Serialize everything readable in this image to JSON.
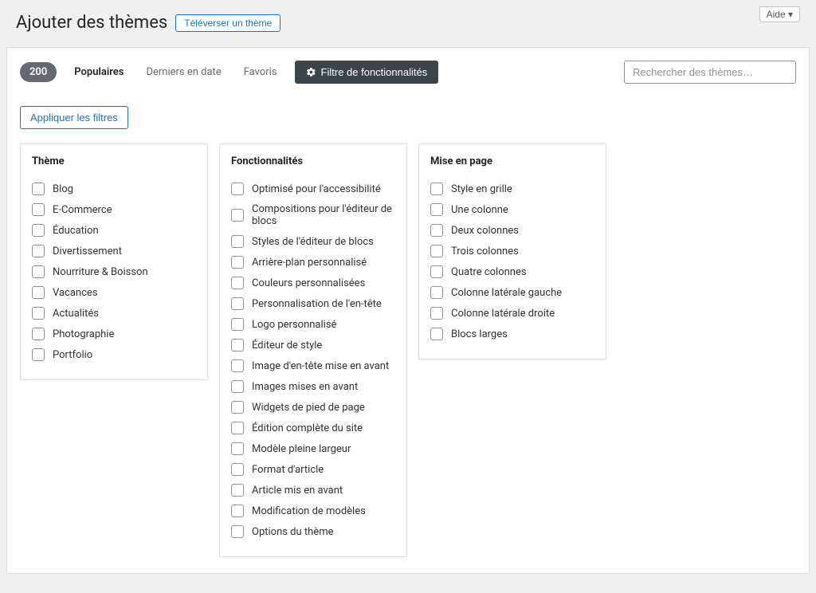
{
  "header": {
    "title": "Ajouter des thèmes",
    "upload_label": "Téléverser un thème",
    "help_label": "Aide ▾"
  },
  "filter_bar": {
    "count": "200",
    "tabs": {
      "popular": "Populaires",
      "latest": "Derniers en date",
      "favorites": "Favoris"
    },
    "feature_filter_label": "Filtre de fonctionnalités",
    "search_placeholder": "Rechercher des thèmes…"
  },
  "apply_label": "Appliquer les filtres",
  "columns": {
    "theme": {
      "title": "Thème",
      "items": [
        "Blog",
        "E-Commerce",
        "Éducation",
        "Divertissement",
        "Nourriture & Boisson",
        "Vacances",
        "Actualités",
        "Photographie",
        "Portfolio"
      ]
    },
    "features": {
      "title": "Fonctionnalités",
      "items": [
        "Optimisé pour l'accessibilité",
        "Compositions pour l'éditeur de blocs",
        "Styles de l'éditeur de blocs",
        "Arrière-plan personnalisé",
        "Couleurs personnalisées",
        "Personnalisation de l'en-tête",
        "Logo personnalisé",
        "Éditeur de style",
        "Image d'en-tête mise en avant",
        "Images mises en avant",
        "Widgets de pied de page",
        "Édition complète du site",
        "Modèle pleine largeur",
        "Format d'article",
        "Article mis en avant",
        "Modification de modèles",
        "Options du thème"
      ]
    },
    "layout": {
      "title": "Mise en page",
      "items": [
        "Style en grille",
        "Une colonne",
        "Deux colonnes",
        "Trois colonnes",
        "Quatre colonnes",
        "Colonne latérale gauche",
        "Colonne latérale droite",
        "Blocs larges"
      ]
    }
  }
}
